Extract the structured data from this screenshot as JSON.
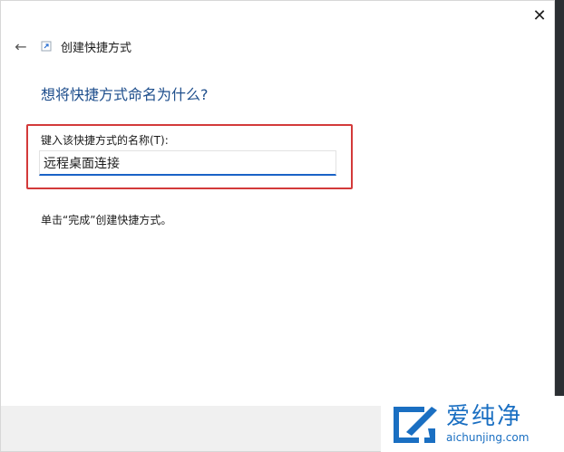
{
  "window": {
    "close_glyph": "✕"
  },
  "nav": {
    "back_glyph": "←",
    "title": "创建快捷方式"
  },
  "main": {
    "heading": "想将快捷方式命名为什么?",
    "field_label": "键入该快捷方式的名称(T):",
    "name_value": "远程桌面连接",
    "hint": "单击“完成”创建快捷方式。"
  },
  "watermark": {
    "brand_cn": "爱纯净",
    "brand_url": "aichunjing.com"
  },
  "colors": {
    "accent": "#1a63c7",
    "highlight": "#d33a3a",
    "heading": "#1e4e8c",
    "watermark": "#1a6fc2"
  }
}
